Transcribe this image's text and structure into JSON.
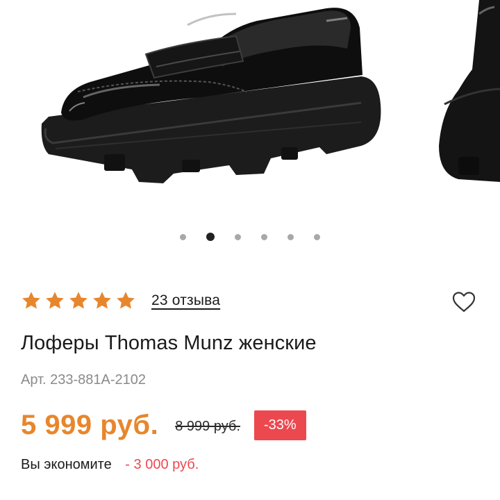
{
  "gallery": {
    "image": "black-patent-loafers-icon",
    "slides_total": 6,
    "active_slide": 2
  },
  "rating": {
    "stars": 5,
    "star_color": "#e8862c",
    "reviews_label": "23 отзыва"
  },
  "product": {
    "title": "Лоферы Thomas Munz женские",
    "sku": "Арт. 233-881A-2102"
  },
  "pricing": {
    "price": "5 999 руб.",
    "old_price": "8 999 руб.",
    "discount": "-33%",
    "savings_label": "Вы экономите",
    "savings_value": "- 3 000 руб.",
    "price_color": "#e8862c",
    "discount_color": "#ec4850"
  },
  "actions": {
    "favorite_icon": "heart-outline-icon"
  }
}
